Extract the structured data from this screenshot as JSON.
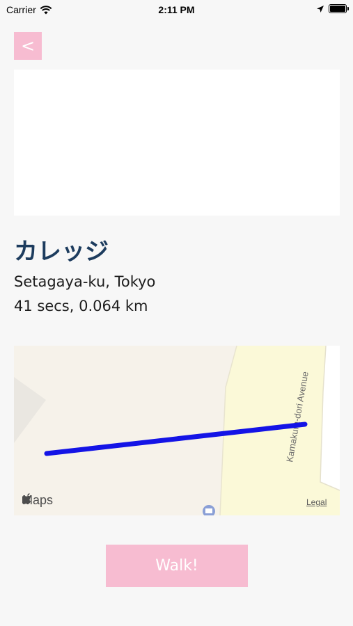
{
  "status_bar": {
    "carrier": "Carrier",
    "time": "2:11 PM"
  },
  "nav": {
    "back_label": "<"
  },
  "place": {
    "name": "カレッジ",
    "location": "Setagaya-ku, Tokyo",
    "stats": "41 secs, 0.064 km"
  },
  "map": {
    "street_label": "Kamakura-dori Avenue",
    "attribution": "Maps",
    "legal_label": "Legal",
    "route_color": "#1414e6"
  },
  "actions": {
    "walk_label": "Walk!"
  },
  "colors": {
    "accent": "#f7bcd1",
    "title": "#1d3c5e"
  }
}
